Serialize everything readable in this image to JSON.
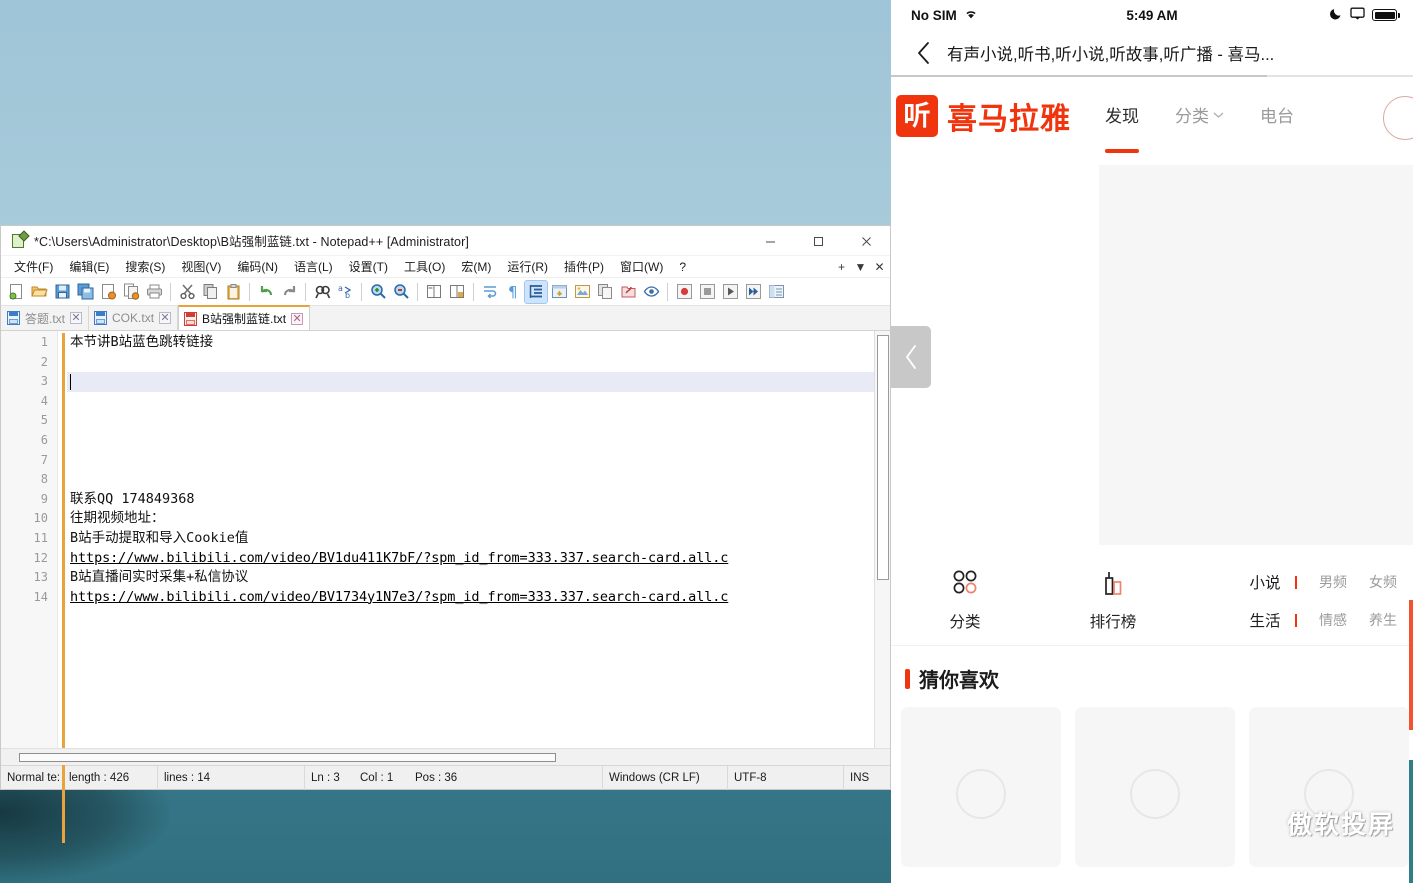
{
  "desktop": {
    "wallpaper_sky": "#aed0dc",
    "wallpaper_water": "#30707f"
  },
  "notepad": {
    "title": "*C:\\Users\\Administrator\\Desktop\\B站强制蓝链.txt - Notepad++ [Administrator]",
    "window_controls": {
      "minimize": "minimize-button",
      "maximize": "maximize-button",
      "close": "close-button"
    },
    "menus": [
      "文件(F)",
      "编辑(E)",
      "搜索(S)",
      "视图(V)",
      "编码(N)",
      "语言(L)",
      "设置(T)",
      "工具(O)",
      "宏(M)",
      "运行(R)",
      "插件(P)",
      "窗口(W)",
      "?"
    ],
    "menu_right": [
      "+",
      "▼",
      "✕"
    ],
    "toolbar": [
      {
        "name": "new-file-icon",
        "glyph": "new"
      },
      {
        "name": "open-file-icon",
        "glyph": "open"
      },
      {
        "name": "save-icon",
        "glyph": "save"
      },
      {
        "name": "save-all-icon",
        "glyph": "saveall"
      },
      {
        "name": "close-file-icon",
        "glyph": "closefile"
      },
      {
        "name": "close-all-files-icon",
        "glyph": "closeall"
      },
      {
        "name": "print-icon",
        "glyph": "print"
      },
      {
        "name": "separator",
        "glyph": "sep"
      },
      {
        "name": "cut-icon",
        "glyph": "cut"
      },
      {
        "name": "copy-icon",
        "glyph": "copy"
      },
      {
        "name": "paste-icon",
        "glyph": "paste"
      },
      {
        "name": "separator",
        "glyph": "sep"
      },
      {
        "name": "undo-icon",
        "glyph": "undo"
      },
      {
        "name": "redo-icon",
        "glyph": "redo"
      },
      {
        "name": "separator",
        "glyph": "sep"
      },
      {
        "name": "find-icon",
        "glyph": "find"
      },
      {
        "name": "replace-icon",
        "glyph": "replace"
      },
      {
        "name": "separator",
        "glyph": "sep"
      },
      {
        "name": "zoom-in-icon",
        "glyph": "zoomin"
      },
      {
        "name": "zoom-out-icon",
        "glyph": "zoomout"
      },
      {
        "name": "separator",
        "glyph": "sep"
      },
      {
        "name": "sync-vertical-scroll-icon",
        "glyph": "syncv"
      },
      {
        "name": "sync-horizontal-scroll-icon",
        "glyph": "synch"
      },
      {
        "name": "separator",
        "glyph": "sep"
      },
      {
        "name": "word-wrap-icon",
        "glyph": "wrap"
      },
      {
        "name": "show-all-characters-icon",
        "glyph": "pilcrow"
      },
      {
        "name": "indent-guide-icon",
        "glyph": "indent"
      },
      {
        "name": "user-defined-dialog-icon",
        "glyph": "udl"
      },
      {
        "name": "document-map-icon",
        "glyph": "map"
      },
      {
        "name": "function-list-icon",
        "glyph": "funclist"
      },
      {
        "name": "folder-as-workspace-icon",
        "glyph": "folderws"
      },
      {
        "name": "monitoring-icon",
        "glyph": "eye"
      },
      {
        "name": "separator",
        "glyph": "sep"
      },
      {
        "name": "record-macro-icon",
        "glyph": "record"
      },
      {
        "name": "stop-macro-icon",
        "glyph": "stop"
      },
      {
        "name": "play-macro-icon",
        "glyph": "play"
      },
      {
        "name": "play-multiple-macro-icon",
        "glyph": "playmulti"
      },
      {
        "name": "save-macro-icon",
        "glyph": "savemacro"
      }
    ],
    "tabs": [
      {
        "label": "答题.txt",
        "active": false
      },
      {
        "label": "COK.txt",
        "active": false
      },
      {
        "label": "B站强制蓝链.txt",
        "active": true
      }
    ],
    "editor": {
      "line_numbers": [
        "1",
        "2",
        "3",
        "4",
        "5",
        "6",
        "7",
        "8",
        "9",
        "10",
        "11",
        "12",
        "13",
        "14"
      ],
      "lines": [
        {
          "text": "本节讲B站蓝色跳转链接",
          "current": false,
          "url": false
        },
        {
          "text": "",
          "current": false,
          "url": false
        },
        {
          "text": "",
          "current": true,
          "url": false
        },
        {
          "text": "",
          "current": false,
          "url": false
        },
        {
          "text": "",
          "current": false,
          "url": false
        },
        {
          "text": "",
          "current": false,
          "url": false
        },
        {
          "text": "",
          "current": false,
          "url": false
        },
        {
          "text": "",
          "current": false,
          "url": false
        },
        {
          "text": "联系QQ 174849368",
          "current": false,
          "url": false
        },
        {
          "text": "往期视频地址：",
          "current": false,
          "url": false
        },
        {
          "text": "B站手动提取和导入Cookie值",
          "current": false,
          "url": false
        },
        {
          "text": "https://www.bilibili.com/video/BV1du411K7bF/?spm_id_from=333.337.search-card.all.c",
          "current": false,
          "url": true
        },
        {
          "text": "B站直播间实时采集+私信协议",
          "current": false,
          "url": false
        },
        {
          "text": "https://www.bilibili.com/video/BV1734y1N7e3/?spm_id_from=333.337.search-card.all.c",
          "current": false,
          "url": true
        }
      ]
    },
    "status": {
      "doc_type": "Normal te:",
      "length": "length : 426",
      "lines": "lines : 14",
      "ln": "Ln : 3",
      "col": "Col : 1",
      "pos": "Pos : 36",
      "eol": "Windows (CR LF)",
      "encoding": "UTF-8",
      "insert_mode": "INS"
    }
  },
  "phone": {
    "status_bar": {
      "carrier": "No SIM",
      "wifi_icon": "wifi-icon",
      "time": "5:49 AM",
      "moon_icon": "moon-icon",
      "screen_mirroring_icon": "screen-mirroring-icon",
      "battery_icon": "battery-icon"
    },
    "browser": {
      "back_icon": "back-chevron-icon",
      "page_title": "有声小说,听书,听小说,听故事,听广播 - 喜马..."
    },
    "site": {
      "logo_glyph": "听",
      "logo_text": "喜马拉雅",
      "brand_color": "#f0340e",
      "nav": [
        {
          "label": "发现",
          "active": true,
          "chevron": false
        },
        {
          "label": "分类",
          "active": false,
          "chevron": true
        },
        {
          "label": "电台",
          "active": false,
          "chevron": false
        }
      ],
      "carousel": {
        "prev_icon": "carousel-prev-arrow-icon"
      },
      "quick_links": [
        {
          "label": "分类",
          "icon": "four-circles-grid-icon"
        },
        {
          "label": "排行榜",
          "icon": "bar-chart-icon"
        }
      ],
      "tag_rows": [
        {
          "main": "小说",
          "subs": [
            "男频",
            "女频"
          ]
        },
        {
          "main": "生活",
          "subs": [
            "情感",
            "养生"
          ]
        }
      ],
      "section_title": "猜你喜欢",
      "cards": [
        "card-1",
        "card-2",
        "card-3"
      ],
      "watermark": "傲软投屏"
    }
  }
}
